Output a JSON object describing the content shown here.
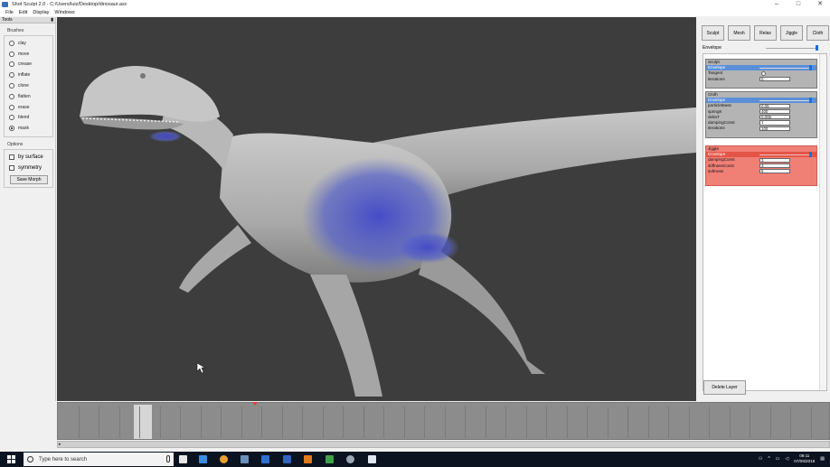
{
  "window": {
    "title": "Shot Sculpt 2.0 - C:/Users/luiz/Desktop/dinosaur.asc",
    "controls": [
      "–",
      "□",
      "✕"
    ]
  },
  "menu": [
    "File",
    "Edit",
    "Display",
    "Windows"
  ],
  "tools": {
    "header": "Tools",
    "brushes_label": "Brushes",
    "brushes": [
      {
        "label": "clay",
        "checked": false
      },
      {
        "label": "move",
        "checked": false
      },
      {
        "label": "crease",
        "checked": false
      },
      {
        "label": "inflate",
        "checked": false
      },
      {
        "label": "clone",
        "checked": false
      },
      {
        "label": "flatten",
        "checked": false
      },
      {
        "label": "erase",
        "checked": false
      },
      {
        "label": "blend",
        "checked": false
      },
      {
        "label": "mask",
        "checked": true
      }
    ],
    "options_label": "Options",
    "options": [
      {
        "label": "by surface",
        "checked": false
      },
      {
        "label": "symmetry",
        "checked": false
      }
    ],
    "save_morph": "Save Morph"
  },
  "right_panel": {
    "tabs": [
      "Sculpt",
      "Mesh",
      "Relax",
      "Jiggle",
      "Cloth"
    ],
    "envelope_label": "Envelope",
    "envelope_value": 1.0,
    "layers": {
      "sculpt": {
        "name": "Sculpt",
        "envelope_label": "Envelope",
        "tangent_label": "Tangent",
        "iterations_label": "iterations",
        "iterations": "0"
      },
      "cloth": {
        "name": "Cloth",
        "envelope_label": "Envelope",
        "rows": [
          {
            "label": "particleMass",
            "value": "0.05"
          },
          {
            "label": "springK",
            "value": "400"
          },
          {
            "label": "deltaT",
            "value": "0.005"
          },
          {
            "label": "dampingConst",
            "value": "1"
          },
          {
            "label": "iterations",
            "value": "100"
          }
        ]
      },
      "jiggle": {
        "name": "Jiggle",
        "envelope_label": "Envelope",
        "rows": [
          {
            "label": "dampingConst",
            "value": "3"
          },
          {
            "label": "stiffnessConst",
            "value": "3"
          },
          {
            "label": "softness",
            "value": "5"
          }
        ]
      }
    },
    "delete_layer": "Delete Layer"
  },
  "taskbar": {
    "search_placeholder": "Type here to search",
    "time": "09:11",
    "date": "07/09/2018"
  },
  "colors": {
    "accent": "#1c6fd6",
    "jiggle_layer": "#f07f76",
    "viewport_bg": "#3d3d3d",
    "mask": "#4d58c8"
  }
}
